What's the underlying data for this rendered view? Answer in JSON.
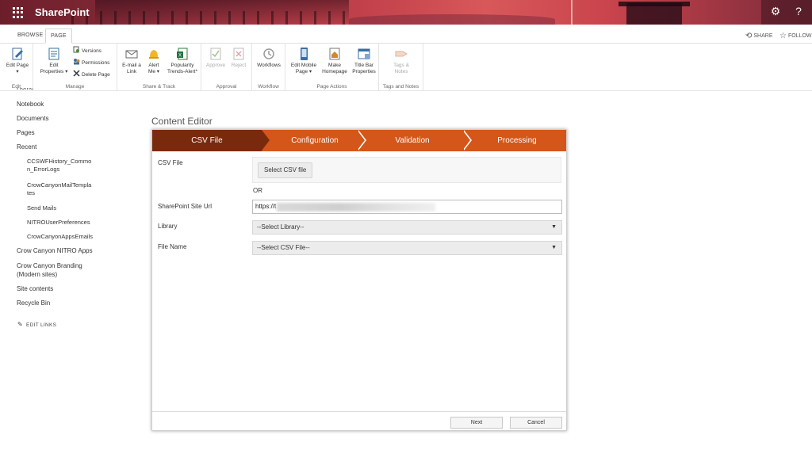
{
  "suite": {
    "brand": "SharePoint",
    "icons": [
      "waffle-icon",
      "gear-icon",
      "help-icon"
    ],
    "help_glyph": "?",
    "gear_glyph": "⚙"
  },
  "ribbon_tabs": {
    "browse": "BROWSE",
    "page": "PAGE",
    "share": "SHARE",
    "follow": "FOLLOW"
  },
  "ribbon": {
    "edit": {
      "label": "Edit",
      "edit_page": "Edit Page",
      "edit_page_caret": "▾"
    },
    "manage": {
      "label": "Manage",
      "edit_properties_1": "Edit",
      "edit_properties_2": "Properties ▾",
      "versions": "Versions",
      "permissions": "Permissions",
      "delete_page": "Delete Page"
    },
    "share_track": {
      "label": "Share & Track",
      "email_1": "E-mail a",
      "email_2": "Link",
      "alert_1": "Alert",
      "alert_2": "Me ▾",
      "popularity_1": "Popularity",
      "popularity_2": "Trends-Alert*"
    },
    "approval": {
      "label": "Approval",
      "approve": "Approve",
      "reject": "Reject"
    },
    "workflow": {
      "label": "Workflow",
      "workflows": "Workflows"
    },
    "page_actions": {
      "label": "Page Actions",
      "edit_mobile_1": "Edit Mobile",
      "edit_mobile_2": "Page ▾",
      "make_home_1": "Make",
      "make_home_2": "Homepage",
      "title_bar_1": "Title Bar",
      "title_bar_2": "Properties"
    },
    "tags": {
      "label": "Tags and Notes",
      "tags_1": "Tags &",
      "tags_2": "Notes"
    }
  },
  "leftnav": {
    "home": "Home",
    "notebook": "Notebook",
    "documents": "Documents",
    "pages": "Pages",
    "recent": "Recent",
    "recent_items": [
      {
        "line1": "CCSWFHistory_Commo",
        "line2": "n_ErrorLogs"
      },
      {
        "line1": "CrowCanyonMailTempla",
        "line2": "tes"
      },
      {
        "line1": "Send Mails",
        "line2": ""
      },
      {
        "line1": "NITROUserPreferences",
        "line2": ""
      },
      {
        "line1": "CrowCanyonAppsEmails",
        "line2": ""
      }
    ],
    "nitro_apps": "Crow Canyon NITRO Apps",
    "branding_1": "Crow Canyon Branding",
    "branding_2": "(Modern sites)",
    "site_contents": "Site contents",
    "recycle_bin": "Recycle Bin",
    "edit_links": "EDIT LINKS"
  },
  "content_editor": {
    "title": "Content Editor",
    "steps": [
      "CSV File",
      "Configuration",
      "Validation",
      "Processing"
    ],
    "active_step": "CSV File",
    "csv_file_label": "CSV File",
    "select_csv_button": "Select CSV file",
    "or_text": "OR",
    "site_url_label": "SharePoint Site Url",
    "site_url_value": "https://t",
    "library_label": "Library",
    "library_selected": "--Select Library--",
    "file_name_label": "File Name",
    "file_name_selected": "--Select CSV File--",
    "next_button": "Next",
    "cancel_button": "Cancel"
  },
  "colors": {
    "step_active": "#7a2a0c",
    "step_inactive": "#d4561a",
    "suite_accent": "#c2414b"
  }
}
